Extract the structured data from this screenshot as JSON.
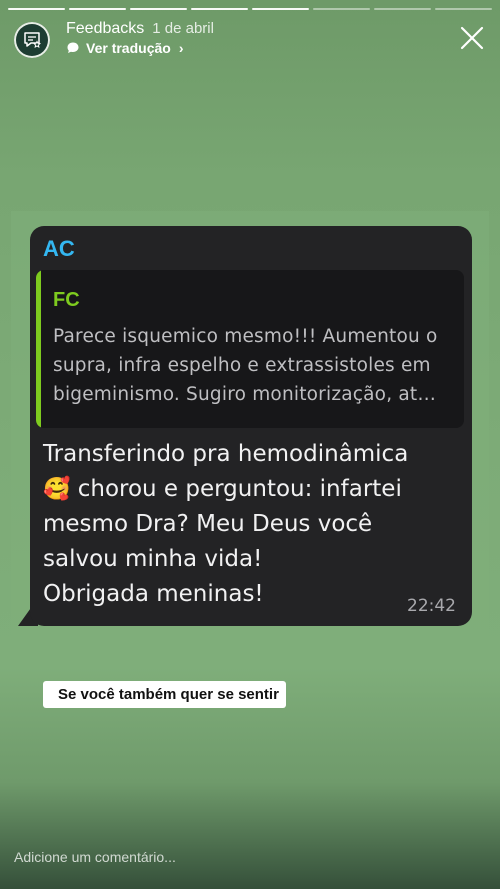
{
  "story": {
    "segments_total": 8,
    "segments_done": 5
  },
  "header": {
    "account_name": "Feedbacks",
    "date": "1 de abril",
    "translate_label": "Ver tradução",
    "avatar_icon": "feedback-chat-icon",
    "close_icon": "close-icon"
  },
  "message": {
    "sender": "AC",
    "quote": {
      "sender": "FC",
      "text": "Parece isquemico mesmo!!! Aumentou o supra, infra espelho e extrassistoles em bigeminismo. Sugiro monitorização, at…"
    },
    "lines": [
      "Transferindo pra hemodinâmica",
      "chorou e perguntou: infartei",
      "mesmo Dra? Meu Deus você",
      "salvou minha vida!",
      "Obrigada meninas!"
    ],
    "emoji": "🥰",
    "time": "22:42"
  },
  "caption": "Se você também quer se sentir",
  "comment_placeholder": "Adicione um comentário...",
  "colors": {
    "background": "#7dab77",
    "bubble": "#232325",
    "sender_ac": "#34b7f1",
    "sender_fc": "#7ecb1f"
  }
}
